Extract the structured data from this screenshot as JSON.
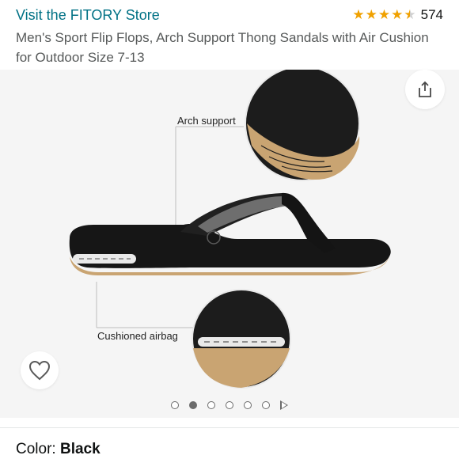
{
  "header": {
    "store_link": "Visit the FITORY Store",
    "rating": {
      "stars": 4.5,
      "max": 5,
      "count": "574"
    },
    "title": "Men's Sport Flip Flops, Arch Support Thong Sandals with Air Cushion for Outdoor Size 7-13"
  },
  "gallery": {
    "callouts": {
      "top": "Arch support",
      "bottom": "Cushioned airbag"
    },
    "dots": {
      "count": 6,
      "active_index": 1,
      "has_video": true
    }
  },
  "color": {
    "label": "Color:",
    "value": "Black"
  },
  "colors": {
    "link": "#007185",
    "star": "#f0a100",
    "sole": "#c9a472"
  }
}
